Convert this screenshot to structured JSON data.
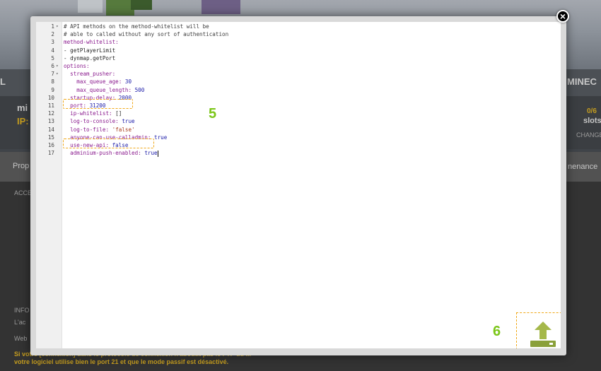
{
  "background": {
    "left_char": "L",
    "server_name_partial": "mi",
    "ip_label": "IP:",
    "tab_partial": "Prop",
    "access_partial": "ACCE",
    "right_label": "MINEC",
    "slots_count": "0/6",
    "slots_label": "slots",
    "change_partial": "CHANGE",
    "maintenance_partial": "nenance",
    "info_partial": "INFO",
    "side_text_1": "L'ac",
    "side_text_2": "Web",
    "footer_line_1": "Si votre [connexion] dans le protocole de connexion n'aboutit pas le FTP du ...",
    "footer_line_2": "votre logiciel utilise bien le port 21 et que le mode passif est désactivé."
  },
  "editor": {
    "lines": [
      {
        "n": "1",
        "fold": true,
        "indent": "",
        "parts": [
          {
            "t": "# API methods on the method-whitelist will be",
            "c": "comment"
          }
        ]
      },
      {
        "n": "2",
        "fold": false,
        "indent": "",
        "parts": [
          {
            "t": "# able to called without any sort of authentication",
            "c": "comment"
          }
        ]
      },
      {
        "n": "3",
        "fold": false,
        "indent": "",
        "parts": [
          {
            "t": "method-whitelist:",
            "c": "key"
          }
        ]
      },
      {
        "n": "4",
        "fold": false,
        "indent": "",
        "parts": [
          {
            "t": "- getPlayerLimit",
            "c": "plain"
          }
        ]
      },
      {
        "n": "5",
        "fold": false,
        "indent": "",
        "parts": [
          {
            "t": "- dynmap.getPort",
            "c": "plain"
          }
        ]
      },
      {
        "n": "6",
        "fold": true,
        "indent": "",
        "parts": [
          {
            "t": "options:",
            "c": "key"
          }
        ]
      },
      {
        "n": "7",
        "fold": true,
        "indent": "  ",
        "parts": [
          {
            "t": "stream_pusher:",
            "c": "key"
          }
        ]
      },
      {
        "n": "8",
        "fold": false,
        "indent": "    ",
        "parts": [
          {
            "t": "max_queue_age: ",
            "c": "key"
          },
          {
            "t": "30",
            "c": "num"
          }
        ]
      },
      {
        "n": "9",
        "fold": false,
        "indent": "    ",
        "parts": [
          {
            "t": "max_queue_length: ",
            "c": "key"
          },
          {
            "t": "500",
            "c": "num"
          }
        ]
      },
      {
        "n": "10",
        "fold": false,
        "indent": "  ",
        "parts": [
          {
            "t": "startup-delay: ",
            "c": "key"
          },
          {
            "t": "2000",
            "c": "num"
          }
        ]
      },
      {
        "n": "11",
        "fold": false,
        "indent": "  ",
        "parts": [
          {
            "t": "port: ",
            "c": "key"
          },
          {
            "t": "31200",
            "c": "num"
          }
        ]
      },
      {
        "n": "12",
        "fold": false,
        "indent": "  ",
        "parts": [
          {
            "t": "ip-whitelist: ",
            "c": "key"
          },
          {
            "t": "[]",
            "c": "plain"
          }
        ]
      },
      {
        "n": "13",
        "fold": false,
        "indent": "  ",
        "parts": [
          {
            "t": "log-to-console: ",
            "c": "key"
          },
          {
            "t": "true",
            "c": "bool"
          }
        ]
      },
      {
        "n": "14",
        "fold": false,
        "indent": "  ",
        "parts": [
          {
            "t": "log-to-file: ",
            "c": "key"
          },
          {
            "t": "'false'",
            "c": "str"
          }
        ]
      },
      {
        "n": "15",
        "fold": false,
        "indent": "  ",
        "parts": [
          {
            "t": "anyone-can-use-calladmin: ",
            "c": "key"
          },
          {
            "t": "true",
            "c": "bool"
          }
        ]
      },
      {
        "n": "16",
        "fold": false,
        "indent": "  ",
        "parts": [
          {
            "t": "use-new-api: ",
            "c": "key"
          },
          {
            "t": "false",
            "c": "bool"
          }
        ]
      },
      {
        "n": "17",
        "fold": false,
        "indent": "  ",
        "parts": [
          {
            "t": "adminium-push-enabled: ",
            "c": "key"
          },
          {
            "t": "true",
            "c": "bool"
          }
        ],
        "cursor": true
      }
    ]
  },
  "annotations": {
    "step_5": "5",
    "step_6": "6"
  },
  "upload_button": {
    "icon": "upload-arrow-icon",
    "colors": {
      "arrow": "#a5b84a",
      "base": "#8aa03a",
      "slot": "#ffffff"
    }
  },
  "close_button": {
    "label": "×"
  },
  "colors": {
    "highlight_dash": "#f0a818",
    "step_number": "#7bc618",
    "modal_frame": "#d9d9d9",
    "editor_bg": "#ffffff"
  }
}
